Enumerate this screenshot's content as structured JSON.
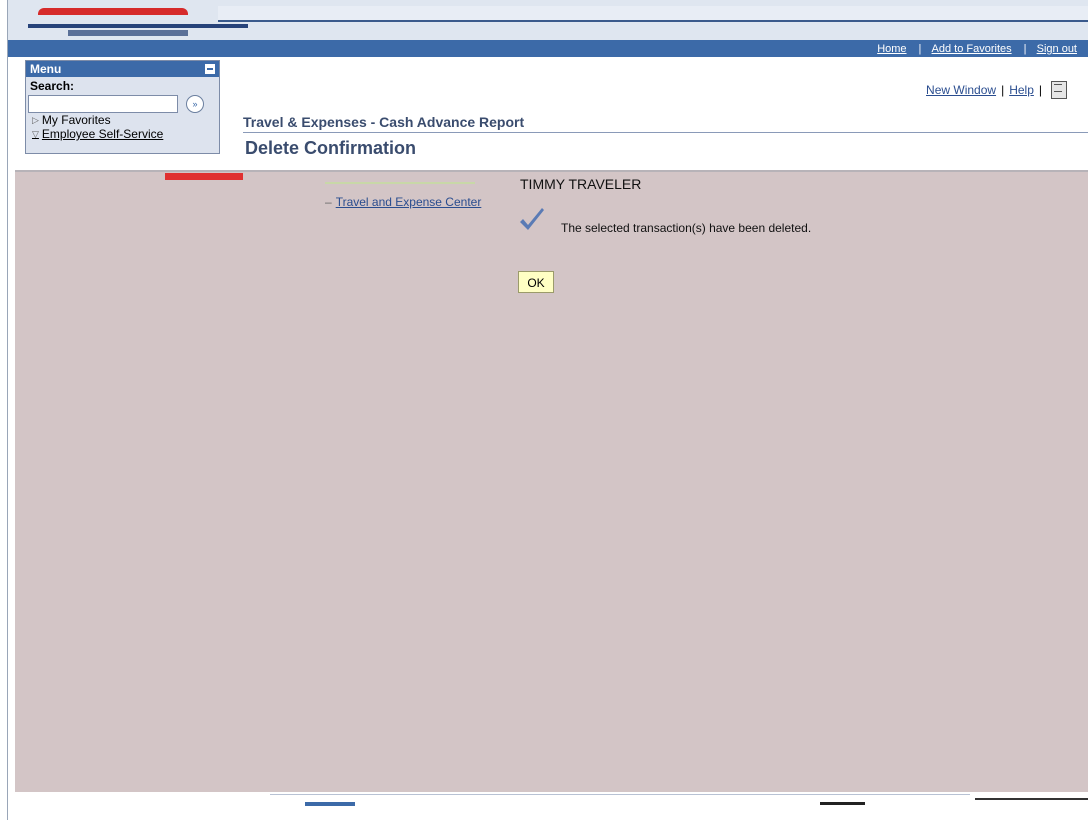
{
  "nav": {
    "home": "Home",
    "add_to_favorites": "Add to Favorites",
    "sign_out": "Sign out"
  },
  "menu": {
    "title": "Menu",
    "search_label": "Search:",
    "search_value": "",
    "items": [
      {
        "label": "My Favorites",
        "state": "collapsed"
      },
      {
        "label": "Employee Self-Service",
        "state": "expanded"
      }
    ]
  },
  "header_links": {
    "new_window": "New Window",
    "help": "Help",
    "http_icon": "http"
  },
  "page": {
    "app_title": "Travel & Expenses - Cash Advance Report",
    "title": "Delete Confirmation"
  },
  "content": {
    "breadcrumb_link": "Travel and Expense Center",
    "user_name": "TIMMY TRAVELER",
    "message": "The selected transaction(s) have been deleted.",
    "ok_label": "OK"
  },
  "colors": {
    "nav_blue": "#3c6aa8",
    "content_bg": "#d3c5c6",
    "ok_button": "#ffffc4",
    "link": "#2a4d8f",
    "check": "#5a7bb5"
  }
}
